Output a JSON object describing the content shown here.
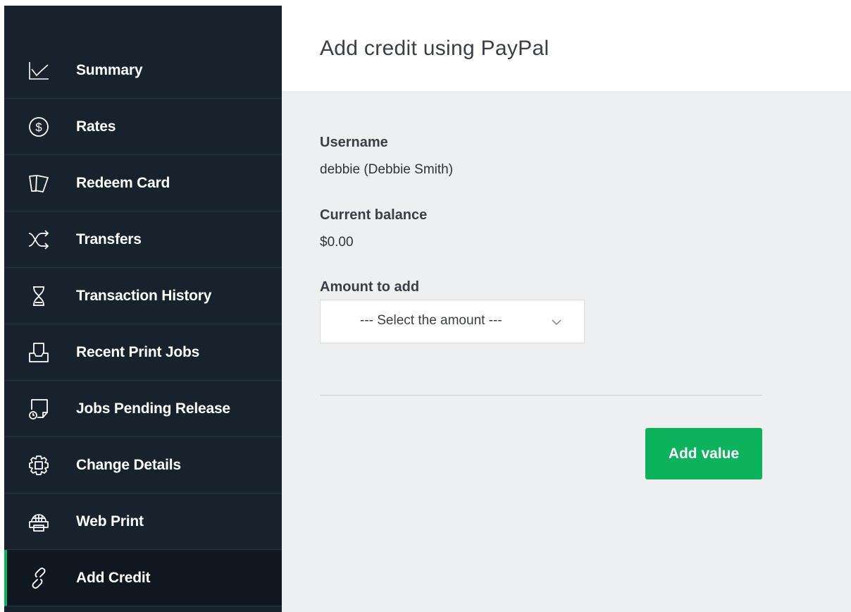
{
  "sidebar": {
    "items": [
      {
        "label": "Summary",
        "icon": "chart-line-icon"
      },
      {
        "label": "Rates",
        "icon": "dollar-circle-icon"
      },
      {
        "label": "Redeem Card",
        "icon": "cards-icon"
      },
      {
        "label": "Transfers",
        "icon": "shuffle-arrows-icon"
      },
      {
        "label": "Transaction History",
        "icon": "hourglass-icon"
      },
      {
        "label": "Recent Print Jobs",
        "icon": "printer-tray-icon"
      },
      {
        "label": "Jobs Pending Release",
        "icon": "pending-document-clock-icon"
      },
      {
        "label": "Change Details",
        "icon": "gear-icon"
      },
      {
        "label": "Web Print",
        "icon": "globe-printer-icon"
      },
      {
        "label": "Add Credit",
        "icon": "link-icon",
        "active": true
      }
    ]
  },
  "main": {
    "title": "Add credit using PayPal",
    "username_label": "Username",
    "username_value": "debbie (Debbie Smith)",
    "balance_label": "Current balance",
    "balance_value": "$0.00",
    "amount_label": "Amount to add",
    "amount_placeholder": "--- Select the amount ---",
    "submit_label": "Add value"
  },
  "colors": {
    "sidebar_bg": "#17222d",
    "active_accent": "#10b060",
    "button_bg": "#0bb35c",
    "content_bg": "#eeeff1"
  }
}
